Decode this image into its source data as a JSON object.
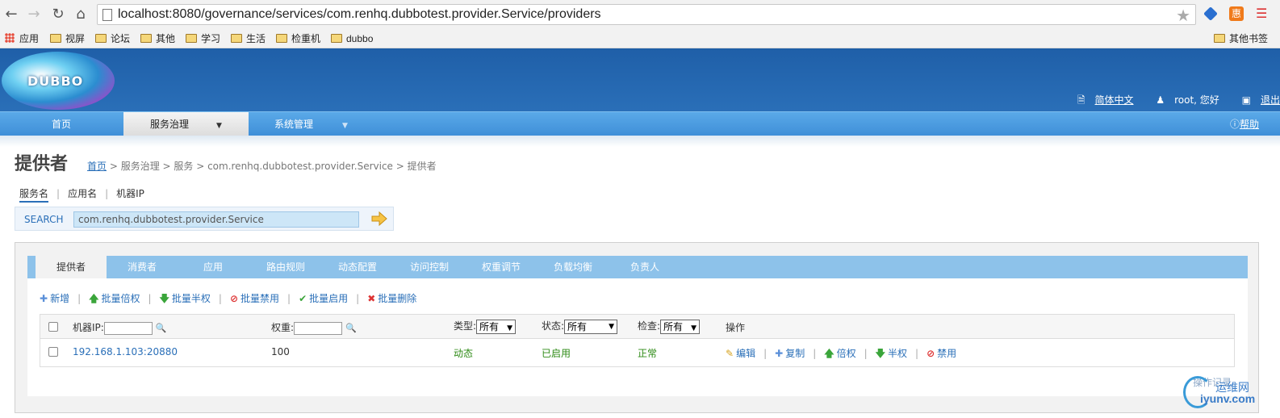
{
  "browser": {
    "url": "localhost:8080/governance/services/com.renhq.dubbotest.provider.Service/providers",
    "bookmarks": [
      "应用",
      "视屏",
      "论坛",
      "其他",
      "学习",
      "生活",
      "检重机",
      "dubbo"
    ],
    "other_bookmarks": "其他书签"
  },
  "header": {
    "logo_text": "DUBBO",
    "lang_link": "简体中文",
    "user_text": "root, 您好",
    "logout_link": "退出"
  },
  "menu": {
    "items": [
      {
        "label": "首页"
      },
      {
        "label": "服务治理"
      },
      {
        "label": "系统管理"
      }
    ],
    "help": "帮助"
  },
  "page": {
    "title": "提供者",
    "breadcrumb": {
      "home": "首页",
      "rest": " > 服务治理 > 服务 > com.renhq.dubbotest.provider.Service > 提供者"
    }
  },
  "search": {
    "tabs": [
      "服务名",
      "应用名",
      "机器IP"
    ],
    "label": "SEARCH",
    "value": "com.renhq.dubbotest.provider.Service"
  },
  "tabs": [
    "提供者",
    "消费者",
    "应用",
    "路由规则",
    "动态配置",
    "访问控制",
    "权重调节",
    "负载均衡",
    "负责人"
  ],
  "actions": {
    "add": "新增",
    "batch_double": "批量倍权",
    "batch_half": "批量半权",
    "batch_disable": "批量禁用",
    "batch_enable": "批量启用",
    "batch_delete": "批量删除"
  },
  "table": {
    "headers": {
      "ip": "机器IP:",
      "weight": "权重:",
      "type": "类型:",
      "status": "状态:",
      "check": "检查:",
      "ops": "操作"
    },
    "filters": {
      "type": "所有",
      "status": "所有",
      "check": "所有"
    },
    "rows": [
      {
        "ip": "192.168.1.103:20880",
        "weight": "100",
        "type": "动态",
        "status": "已启用",
        "check": "正常",
        "ops": {
          "edit": "编辑",
          "copy": "复制",
          "double": "倍权",
          "half": "半权",
          "disable": "禁用"
        }
      }
    ]
  },
  "footer": {
    "log_link": "操作记录",
    "watermark_cn": "运维网",
    "watermark_en": "iyunv.com"
  }
}
